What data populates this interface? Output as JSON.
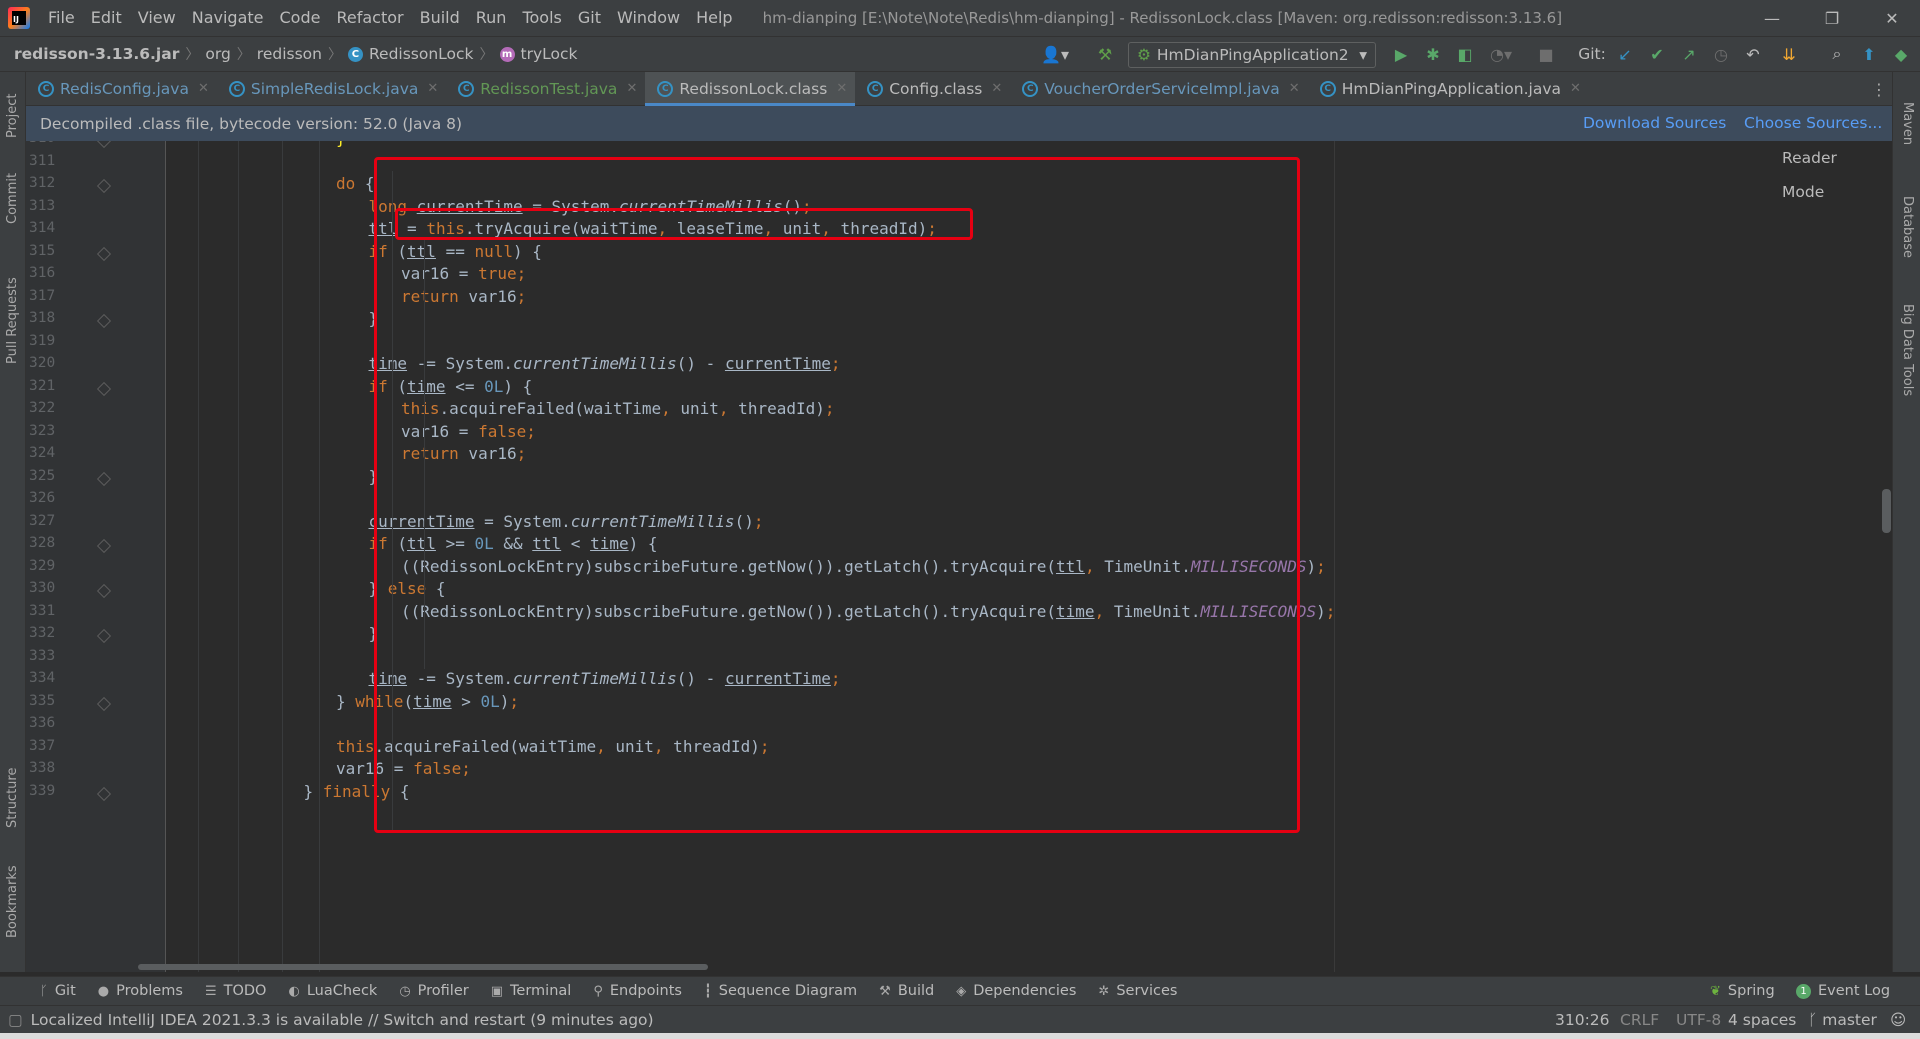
{
  "app": {
    "menu": [
      "File",
      "Edit",
      "View",
      "Navigate",
      "Code",
      "Refactor",
      "Build",
      "Run",
      "Tools",
      "Git",
      "Window",
      "Help"
    ],
    "window_title": "hm-dianping [E:\\Note\\Note\\Redis\\hm-dianping] - RedissonLock.class [Maven: org.redisson:redisson:3.13.6]"
  },
  "breadcrumb": {
    "jar": "redisson-3.13.6.jar",
    "pkg1": "org",
    "pkg2": "redisson",
    "cls": "RedissonLock",
    "method": "tryLock"
  },
  "toolbar": {
    "run_config": "HmDianPingApplication2",
    "git_label": "Git:"
  },
  "tabs": [
    {
      "label": "RedisConfig.java",
      "color": "#6897bb"
    },
    {
      "label": "SimpleRedisLock.java",
      "color": "#6897bb"
    },
    {
      "label": "RedissonTest.java",
      "color": "#629755"
    },
    {
      "label": "RedissonLock.class",
      "color": "#bbbbbb",
      "active": true
    },
    {
      "label": "Config.class",
      "color": "#bbbbbb"
    },
    {
      "label": "VoucherOrderServiceImpl.java",
      "color": "#6897bb"
    },
    {
      "label": "HmDianPingApplication.java",
      "color": "#bbbbbb"
    }
  ],
  "banner": {
    "text": "Decompiled .class file, bytecode version: 52.0 (Java 8)",
    "download_sources": "Download Sources",
    "choose_sources": "Choose Sources..."
  },
  "editor": {
    "reader_mode": "Reader Mode",
    "lines": [
      {
        "n": "310",
        "indent": 0,
        "html": "<span style=\"color:#ffef28\">}</span>"
      },
      {
        "n": "311",
        "indent": 0,
        "html": ""
      },
      {
        "n": "312",
        "indent": 0,
        "html": "<span class=\"kw\">do</span> {"
      },
      {
        "n": "313",
        "indent": 1,
        "html": "<span class=\"kw\">long</span> <span class=\"var-u\">currentTime</span> = System.<span class=\"italic\">currentTimeMillis</span>()<span class=\"kw\">;</span>"
      },
      {
        "n": "314",
        "indent": 1,
        "html": "<span class=\"var-u\">ttl</span> = <span class=\"kw\">this</span>.tryAcquire(waitTime<span class=\"kw\">,</span> leaseTime<span class=\"kw\">,</span> unit<span class=\"kw\">,</span> threadId)<span class=\"kw\">;</span>"
      },
      {
        "n": "315",
        "indent": 1,
        "html": "<span class=\"kw\">if</span> (<span class=\"var-u\">ttl</span> == <span class=\"kw\">null</span>) {"
      },
      {
        "n": "316",
        "indent": 2,
        "html": "var16 = <span class=\"kw\">true;</span>"
      },
      {
        "n": "317",
        "indent": 2,
        "html": "<span class=\"kw\">return</span> var16<span class=\"kw\">;</span>"
      },
      {
        "n": "318",
        "indent": 1,
        "html": "}"
      },
      {
        "n": "319",
        "indent": 0,
        "html": ""
      },
      {
        "n": "320",
        "indent": 1,
        "html": "<span class=\"var-u\">time</span> -= System.<span class=\"italic\">currentTimeMillis</span>() - <span class=\"var-u\">currentTime</span><span class=\"kw\">;</span>"
      },
      {
        "n": "321",
        "indent": 1,
        "html": "<span class=\"kw\">if</span> (<span class=\"var-u\">time</span> &lt;= <span class=\"num\">0L</span>) {"
      },
      {
        "n": "322",
        "indent": 2,
        "html": "<span class=\"kw\">this</span>.acquireFailed(waitTime<span class=\"kw\">,</span> unit<span class=\"kw\">,</span> threadId)<span class=\"kw\">;</span>"
      },
      {
        "n": "323",
        "indent": 2,
        "html": "var16 = <span class=\"kw\">false;</span>"
      },
      {
        "n": "324",
        "indent": 2,
        "html": "<span class=\"kw\">return</span> var16<span class=\"kw\">;</span>"
      },
      {
        "n": "325",
        "indent": 1,
        "html": "}"
      },
      {
        "n": "326",
        "indent": 0,
        "html": ""
      },
      {
        "n": "327",
        "indent": 1,
        "html": "<span class=\"var-u\">currentTime</span> = System.<span class=\"italic\">currentTimeMillis</span>()<span class=\"kw\">;</span>"
      },
      {
        "n": "328",
        "indent": 1,
        "html": "<span class=\"kw\">if</span> (<span class=\"var-u\">ttl</span> &gt;= <span class=\"num\">0L</span> &amp;&amp; <span class=\"var-u\">ttl</span> &lt; <span class=\"var-u\">time</span>) {"
      },
      {
        "n": "329",
        "indent": 2,
        "html": "((RedissonLockEntry)subscribeFuture.getNow()).getLatch().tryAcquire(<span class=\"var-u\">ttl</span><span class=\"kw\">,</span> TimeUnit.<span class=\"const\">MILLISECONDS</span>)<span class=\"kw\">;</span>"
      },
      {
        "n": "330",
        "indent": 1,
        "html": "} <span class=\"kw\">else</span> {"
      },
      {
        "n": "331",
        "indent": 2,
        "html": "((RedissonLockEntry)subscribeFuture.getNow()).getLatch().tryAcquire(<span class=\"var-u\">time</span><span class=\"kw\">,</span> TimeUnit.<span class=\"const\">MILLISECONDS</span>)<span class=\"kw\">;</span>"
      },
      {
        "n": "332",
        "indent": 1,
        "html": "}"
      },
      {
        "n": "333",
        "indent": 0,
        "html": ""
      },
      {
        "n": "334",
        "indent": 1,
        "html": "<span class=\"var-u\">time</span> -= System.<span class=\"italic\">currentTimeMillis</span>() - <span class=\"var-u\">currentTime</span><span class=\"kw\">;</span>"
      },
      {
        "n": "335",
        "indent": 0,
        "html": "} <span class=\"kw\">while</span>(<span class=\"var-u\">time</span> &gt; <span class=\"num\">0L</span>)<span class=\"kw\">;</span>"
      },
      {
        "n": "336",
        "indent": 0,
        "html": ""
      },
      {
        "n": "337",
        "indent": 0,
        "html": "<span class=\"kw\">this</span>.acquireFailed(waitTime<span class=\"kw\">,</span> unit<span class=\"kw\">,</span> threadId)<span class=\"kw\">;</span>"
      },
      {
        "n": "338",
        "indent": 0,
        "html": "var16 = <span class=\"kw\">false;</span>"
      },
      {
        "n": "339",
        "indent": -1,
        "html": "} <span class=\"kw\">finally</span> {"
      }
    ]
  },
  "left_tools": [
    "Project",
    "Commit",
    "Pull Requests",
    "Structure",
    "Bookmarks"
  ],
  "right_tools": [
    "Maven",
    "Database",
    "Big Data Tools"
  ],
  "bottom_tools": [
    {
      "icon": "git-icon",
      "glyph": "ᚴ",
      "label": "Git"
    },
    {
      "icon": "problems-icon",
      "glyph": "●",
      "label": "Problems"
    },
    {
      "icon": "todo-icon",
      "glyph": "☰",
      "label": "TODO"
    },
    {
      "icon": "luacheck-icon",
      "glyph": "◐",
      "label": "LuaCheck"
    },
    {
      "icon": "profiler-icon",
      "glyph": "◷",
      "label": "Profiler"
    },
    {
      "icon": "terminal-icon",
      "glyph": "▣",
      "label": "Terminal"
    },
    {
      "icon": "endpoints-icon",
      "glyph": "⚲",
      "label": "Endpoints"
    },
    {
      "icon": "sequence-diagram-icon",
      "glyph": "┇",
      "label": "Sequence Diagram"
    },
    {
      "icon": "build-icon",
      "glyph": "⚒",
      "label": "Build"
    },
    {
      "icon": "dependencies-icon",
      "glyph": "◈",
      "label": "Dependencies"
    },
    {
      "icon": "services-icon",
      "glyph": "✲",
      "label": "Services"
    }
  ],
  "bottom_right_tools": {
    "spring": "Spring",
    "event_log": "Event Log",
    "event_count": "1"
  },
  "status": {
    "message": "Localized IntelliJ IDEA 2021.3.3 is available // Switch and restart (9 minutes ago)",
    "position": "310:26",
    "line_sep": "CRLF",
    "encoding": "UTF-8",
    "indent": "4 spaces",
    "branch": "master"
  }
}
